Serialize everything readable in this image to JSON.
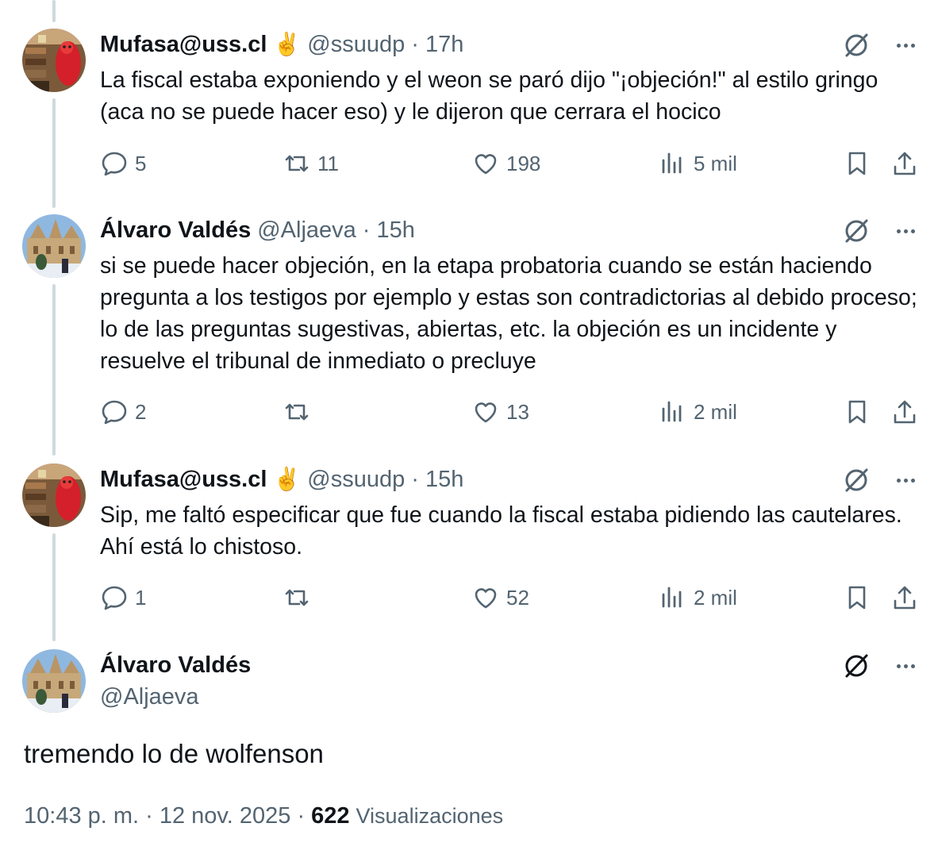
{
  "tweets": [
    {
      "name": "Mufasa@uss.cl",
      "emoji": "✌️",
      "handle": "@ssuudp",
      "time": "· 17h",
      "text": "La fiscal estaba exponiendo y el weon se paró dijo \"¡objeción!\" al estilo gringo (aca no se puede hacer eso) y le dijeron que cerrara el hocico",
      "replies": "5",
      "retweets": "11",
      "likes": "198",
      "views": "5 mil"
    },
    {
      "name": "Álvaro Valdés",
      "handle": "@Aljaeva",
      "time": "· 15h",
      "text": "si se puede hacer objeción, en la etapa probatoria cuando se están haciendo pregunta a los testigos por ejemplo y estas son contradictorias al debido proceso; lo de las preguntas sugestivas, abiertas, etc. la objeción es un incidente y resuelve el tribunal de inmediato o precluye",
      "replies": "2",
      "retweets": "",
      "likes": "13",
      "views": "2 mil"
    },
    {
      "name": "Mufasa@uss.cl",
      "emoji": "✌️",
      "handle": "@ssuudp",
      "time": "· 15h",
      "text": "Sip, me faltó especificar que fue cuando la fiscal estaba pidiendo las cautelares. Ahí está lo chistoso.",
      "replies": "1",
      "retweets": "",
      "likes": "52",
      "views": "2 mil"
    }
  ],
  "main_tweet": {
    "name": "Álvaro Valdés",
    "handle": "@Aljaeva",
    "text": "tremendo lo de wolfenson",
    "timestamp": "10:43 p. m. · 12 nov. 2025 ·",
    "views_count": "622",
    "views_label": "Visualizaciones"
  },
  "colors": {
    "text": "#0f1419",
    "secondary": "#536471",
    "thread_line": "#cfd9de"
  }
}
